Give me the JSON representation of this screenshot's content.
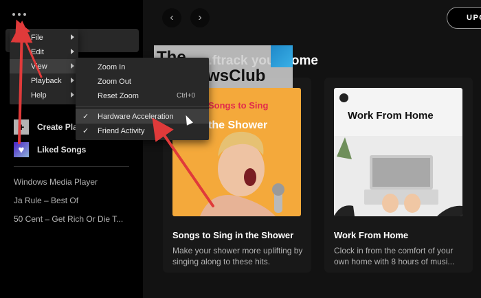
{
  "sidebar": {
    "create_playlist": "Create Pla",
    "liked_songs": "Liked Songs",
    "playlists": [
      "Windows Media Player",
      "Ja Rule – Best Of",
      "50 Cent – Get Rich Or Die T..."
    ]
  },
  "header": {
    "upgrade": "UPG"
  },
  "main": {
    "section_title": "...ftrack your home",
    "cards": [
      {
        "title": "Songs to Sing in the Shower",
        "description": "Make your shower more uplifting by singing along to these hits.",
        "cover_line1": "Songs to Sing",
        "cover_line2": "the Shower"
      },
      {
        "title": "Work From Home",
        "description": "Clock in from the comfort of your own home with 8 hours of musi...",
        "cover_line1": "Work From Home"
      }
    ]
  },
  "watermark": {
    "line1": "The",
    "line2": "WindowsClub"
  },
  "menu": {
    "main_items": [
      "File",
      "Edit",
      "View",
      "Playback",
      "Help"
    ],
    "view_items": [
      {
        "label": "Zoom In",
        "shortcut": ""
      },
      {
        "label": "Zoom Out",
        "shortcut": ""
      },
      {
        "label": "Reset Zoom",
        "shortcut": "Ctrl+0"
      }
    ],
    "toggle_items": [
      {
        "label": "Hardware Acceleration",
        "checked": "✓"
      },
      {
        "label": "Friend Activity",
        "checked": "✓"
      }
    ]
  },
  "colors": {
    "annotation_arrow": "#e03a3a",
    "background": "#121212",
    "sidebar": "#000000"
  }
}
